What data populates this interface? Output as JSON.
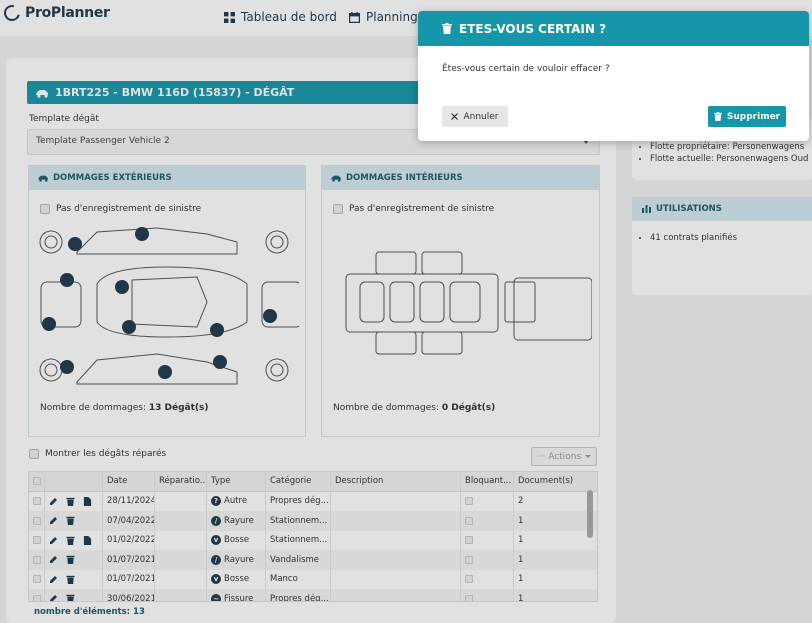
{
  "app": {
    "logo": "ProPlanner"
  },
  "nav": {
    "dashboard": "Tableau de bord",
    "planning": "Planning"
  },
  "page": {
    "title": "1BRT225 - BMW 116D (15837) - DÉGÂT",
    "template_label": "Template dégât",
    "template_value": "Template Passenger Vehicle 2"
  },
  "ext_panel": {
    "title": "DOMMAGES EXTÉRIEURS",
    "no_claim": "Pas d'enregistrement de sinistre",
    "count_label": "Nombre de dommages:",
    "count_value": "13 Dégât(s)"
  },
  "int_panel": {
    "title": "DOMMAGES INTÉRIEURS",
    "no_claim": "Pas d'enregistrement de sinistre",
    "count_label": "Nombre de dommages:",
    "count_value": "0 Dégât(s)"
  },
  "table_controls": {
    "show_repaired": "Montrer les dégâts réparés",
    "actions": "··· Actions"
  },
  "table": {
    "headers": [
      "",
      "",
      "Date",
      "Réparatio...",
      "Type",
      "Catégorie",
      "Description",
      "Bloquant...",
      "Document(s)"
    ],
    "rows": [
      {
        "date": "28/11/2024",
        "type": "Autre",
        "category": "Propres dég...",
        "docs": "2"
      },
      {
        "date": "07/04/2022",
        "type": "Rayure",
        "category": "Stationnem...",
        "docs": "1"
      },
      {
        "date": "01/02/2022",
        "type": "Bosse",
        "category": "Stationnem...",
        "docs": "1"
      },
      {
        "date": "01/07/2021",
        "type": "Rayure",
        "category": "Vandalisme",
        "docs": "1"
      },
      {
        "date": "01/07/2021",
        "type": "Bosse",
        "category": "Manco",
        "docs": "1"
      },
      {
        "date": "30/06/2021",
        "type": "Fissure",
        "category": "Propres dég...",
        "docs": "1"
      }
    ],
    "footer": "nombre d'éléments: 13"
  },
  "right": {
    "owner_fleet": "Flotte propriétaire: Personenwagens",
    "current_fleet": "Flotte actuelle: Personenwagens Oud",
    "usage_title": "UTILISATIONS",
    "usage_item": "41 contrats planifiés"
  },
  "modal": {
    "title": "ETES-VOUS CERTAIN ?",
    "message": "Êtes-vous certain de vouloir effacer ?",
    "cancel": "Annuler",
    "delete": "Supprimer"
  },
  "colors": {
    "accent": "#1597a9",
    "navy": "#1e3a4c",
    "panel_head": "#d4e9ef"
  }
}
